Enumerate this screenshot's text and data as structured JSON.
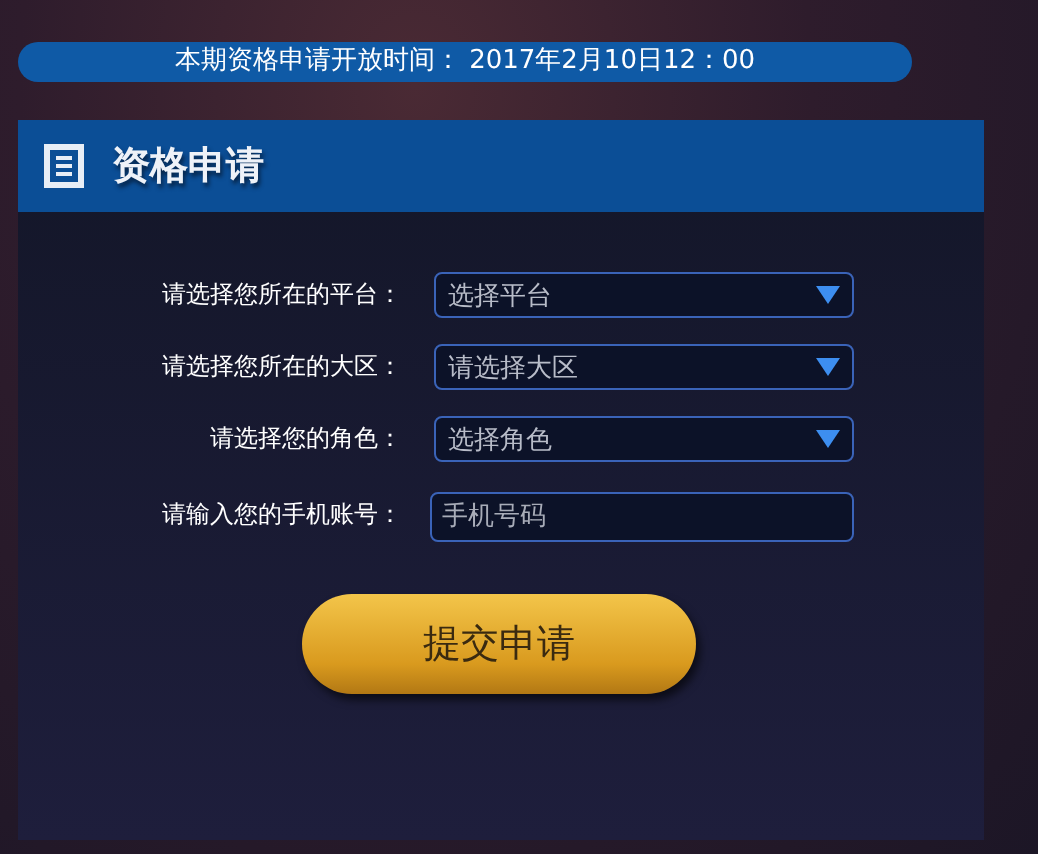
{
  "notice": "本期资格申请开放时间： 2017年2月10日12：00",
  "panel": {
    "title": "资格申请"
  },
  "fields": [
    {
      "label": "请选择您所在的平台：",
      "kind": "select",
      "placeholder": "选择平台"
    },
    {
      "label": "请选择您所在的大区：",
      "kind": "select",
      "placeholder": "请选择大区"
    },
    {
      "label": "请选择您的角色：",
      "kind": "select",
      "placeholder": "选择角色"
    },
    {
      "label": "请输入您的手机账号：",
      "kind": "input",
      "placeholder": "手机号码"
    }
  ],
  "submit": "提交申请"
}
